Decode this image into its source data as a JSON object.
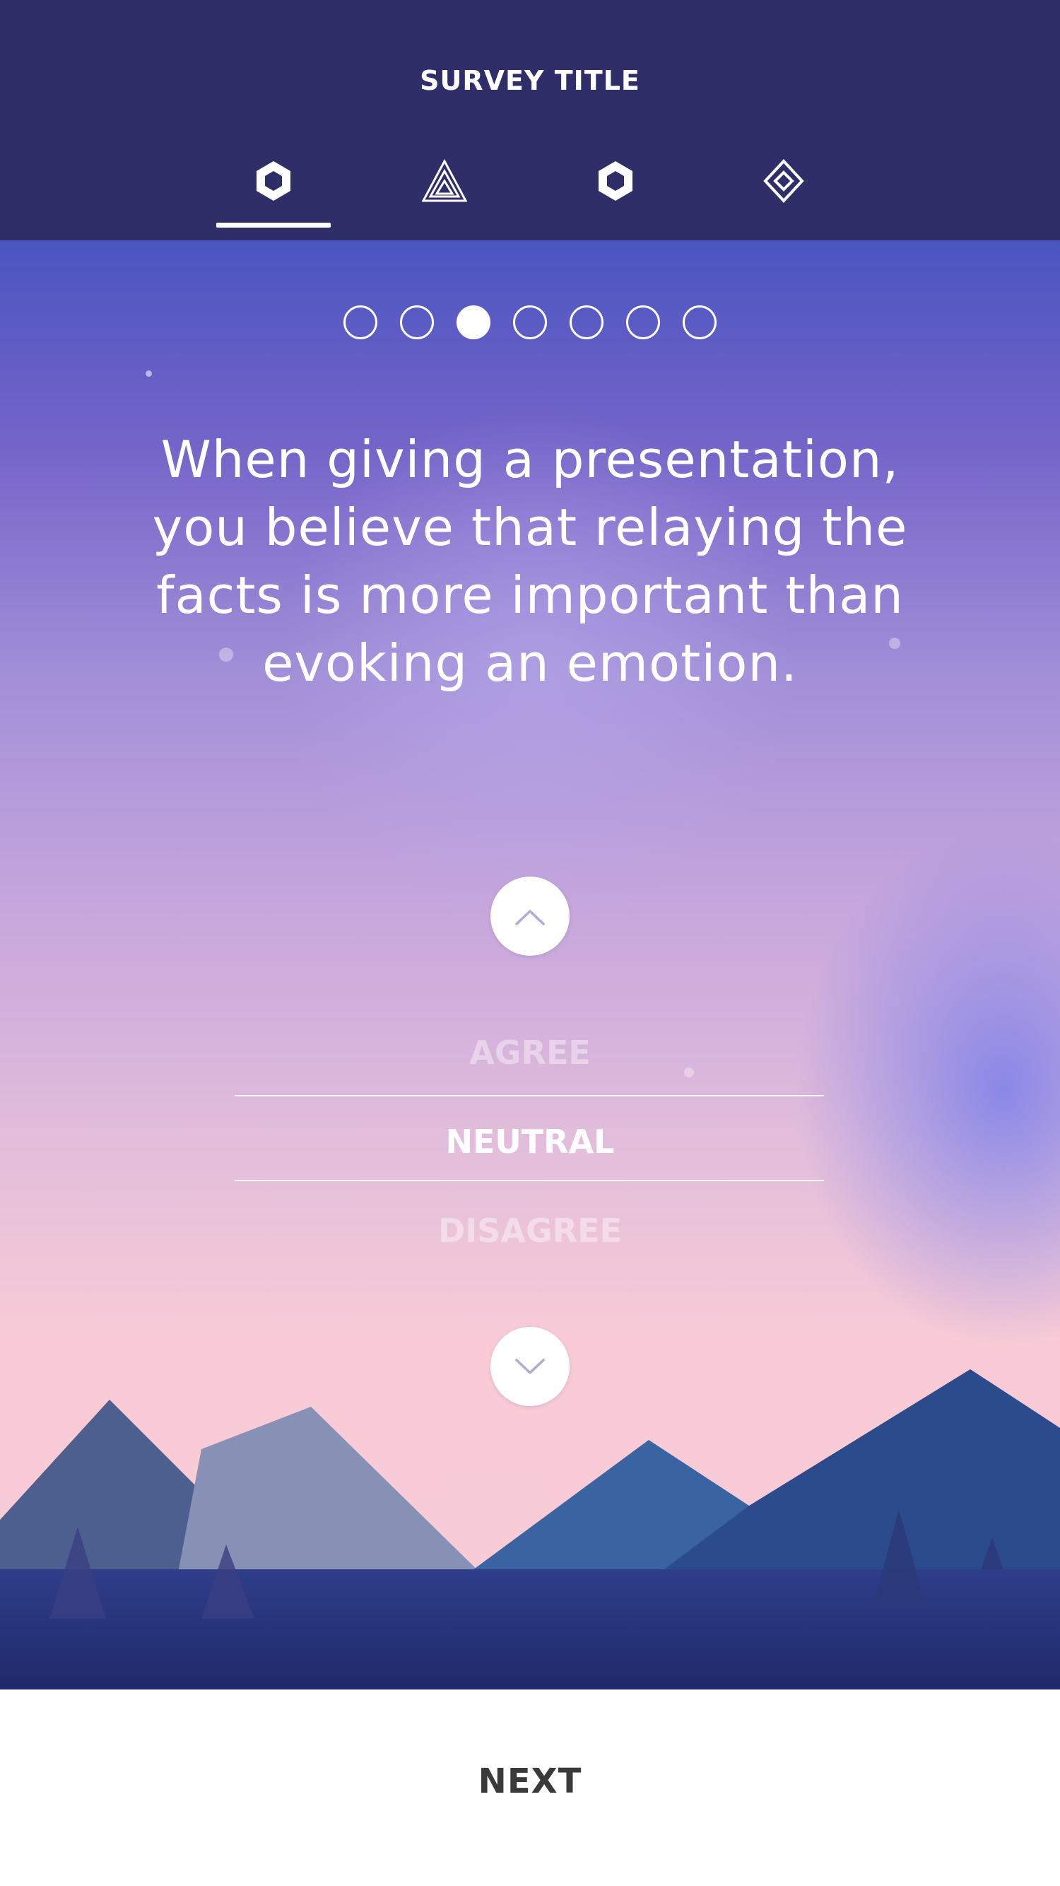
{
  "header": {
    "title": "SURVEY TITLE",
    "tabs": [
      {
        "icon": "hexagon-icon",
        "active": true
      },
      {
        "icon": "triangle-icon",
        "active": false
      },
      {
        "icon": "hexagon-icon",
        "active": false
      },
      {
        "icon": "diamond-icon",
        "active": false
      }
    ]
  },
  "progress": {
    "total": 7,
    "current": 3
  },
  "question": {
    "text": "When giving a presentation, you believe that relaying the facts is more important than evoking an emotion."
  },
  "answer_picker": {
    "options": [
      "AGREE",
      "NEUTRAL",
      "DISAGREE"
    ],
    "selected": "NEUTRAL",
    "up_icon": "chevron-up-icon",
    "down_icon": "chevron-down-icon"
  },
  "footer": {
    "next_label": "NEXT"
  },
  "colors": {
    "header_bg": "#302e68",
    "accent_white": "#ffffff",
    "chevron": "#b7a7d8",
    "next_text": "#3a3a3a"
  }
}
